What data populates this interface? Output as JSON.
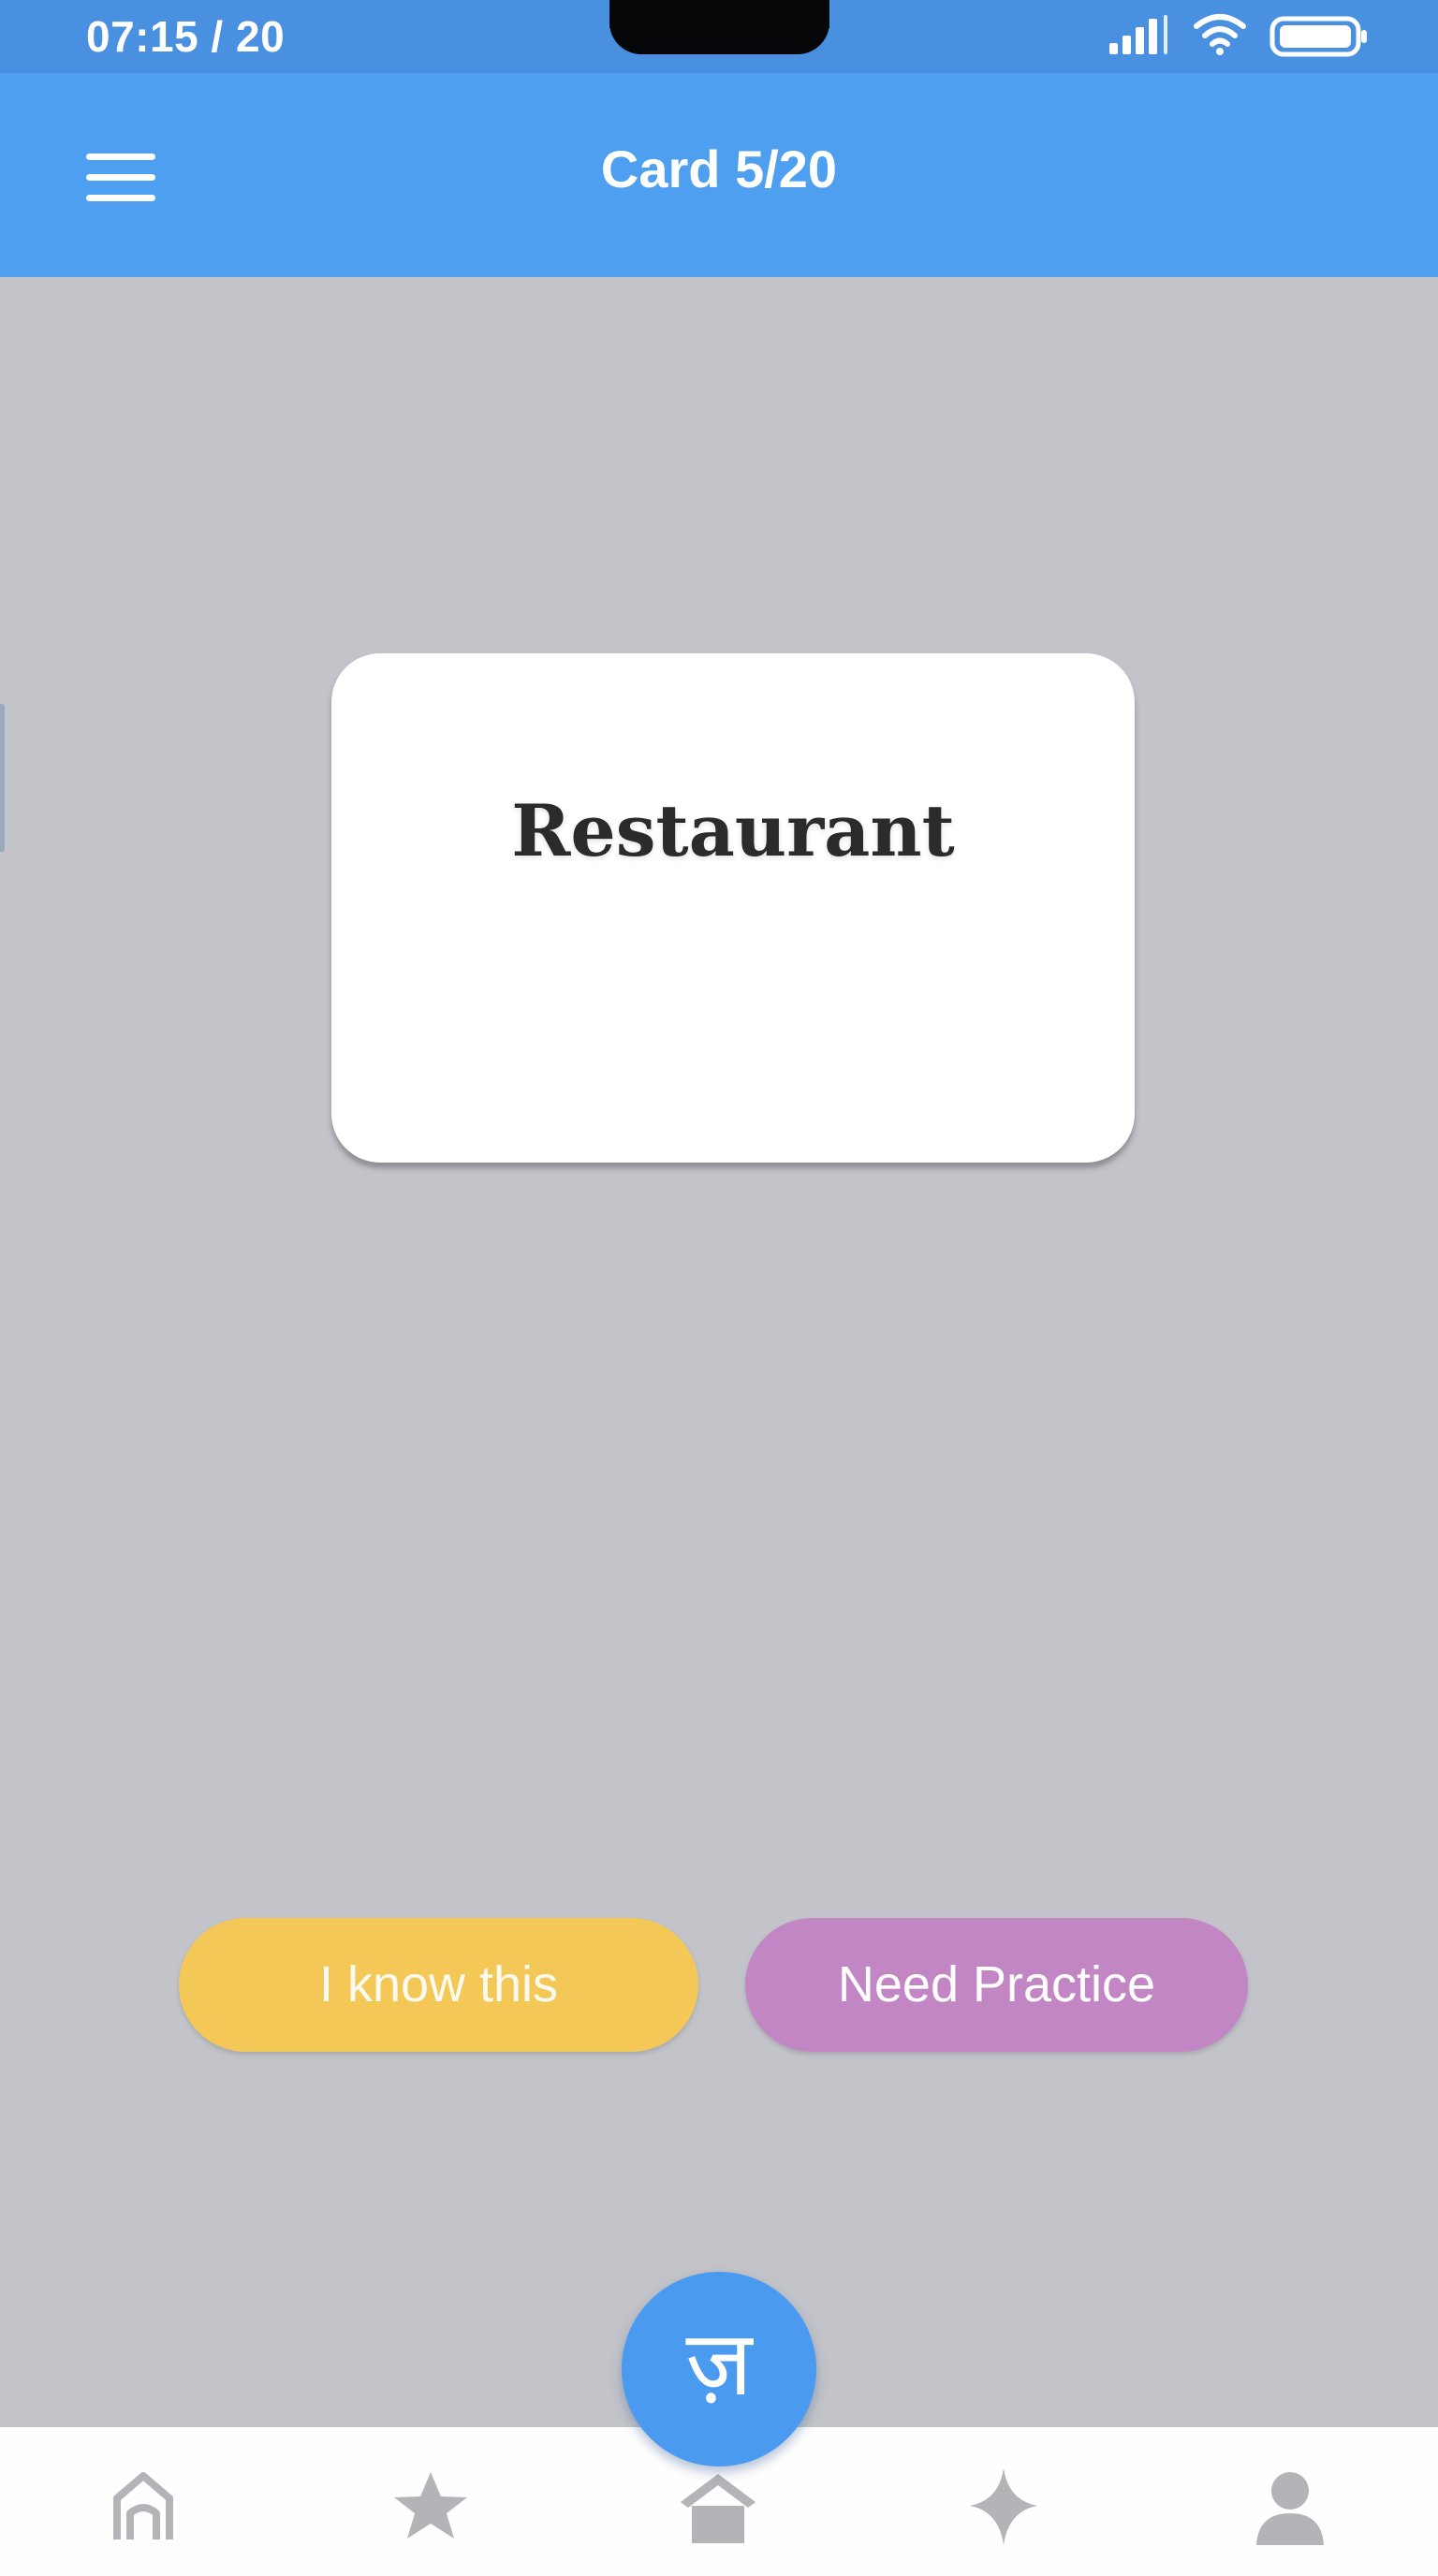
{
  "status_bar": {
    "time": "07:15 / 20",
    "icons": [
      "signal-icon",
      "wifi-icon",
      "battery-icon"
    ]
  },
  "app_bar": {
    "title": "Card 5/20",
    "menu_icon": "hamburger-menu-icon"
  },
  "flashcard": {
    "word": "Restaurant"
  },
  "actions": {
    "know_label": "I know this",
    "practice_label": "Need Practice"
  },
  "fab": {
    "glyph": "ज़"
  },
  "bottom_nav": {
    "items": [
      "home-outline-icon",
      "star-icon",
      "house-icon",
      "sparkle-icon",
      "profile-icon"
    ]
  },
  "colors": {
    "status_bar": "#4a90e0",
    "app_bar": "#4f9ff0",
    "background": "#c3c4c9",
    "know_button": "#f4c857",
    "practice_button": "#c286c4",
    "fab": "#4a9af0",
    "nav_icon": "#b4b4b8"
  }
}
